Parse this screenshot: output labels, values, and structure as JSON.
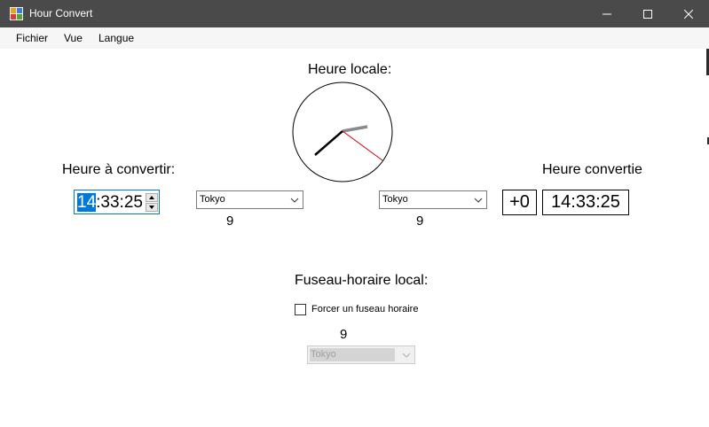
{
  "window": {
    "title": "Hour Convert",
    "controls": {
      "minimize": "minimize",
      "maximize": "maximize",
      "close": "close"
    }
  },
  "menu": [
    {
      "label": "Fichier"
    },
    {
      "label": "Vue"
    },
    {
      "label": "Langue"
    }
  ],
  "local_clock": {
    "label": "Heure locale:"
  },
  "input_section": {
    "label": "Heure à convertir:",
    "time_hours": "14",
    "time_rest": ":33:25",
    "timezone": "Tokyo",
    "offset": "9"
  },
  "output_section": {
    "label": "Heure convertie",
    "timezone": "Tokyo",
    "offset": "9",
    "difference": "+0",
    "time": "14:33:25"
  },
  "local_timezone": {
    "label": "Fuseau-horaire local:",
    "force_label": "Forcer un fuseau horaire",
    "force_checked": false,
    "offset": "9",
    "timezone": "Tokyo"
  },
  "colors": {
    "titlebar": "#4a4a4a",
    "selection": "#0078d7",
    "second_hand": "#cc0000"
  }
}
